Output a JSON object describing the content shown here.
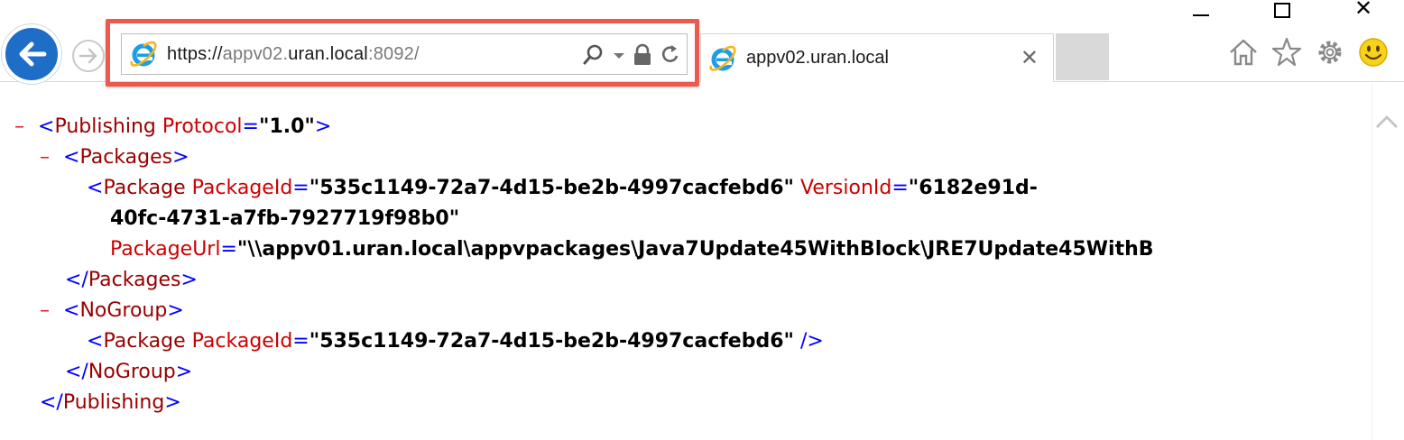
{
  "window": {
    "minimize_icon": "minimize-icon",
    "maximize_icon": "maximize-icon",
    "close_glyph": "✕"
  },
  "nav": {
    "back_icon": "back-arrow-icon",
    "forward_icon": "forward-arrow-icon"
  },
  "address": {
    "scheme": "https://",
    "host_prefix": "appv02.",
    "host_main": "uran.local",
    "port_path": ":8092/",
    "tools": [
      "search-icon",
      "dropdown-icon",
      "lock-icon",
      "refresh-icon"
    ]
  },
  "tab": {
    "title": "appv02.uran.local",
    "close_glyph": "✕"
  },
  "toolbar_icons": [
    "home-icon",
    "favorites-star-icon",
    "settings-gear-icon",
    "smiley-feedback-icon"
  ],
  "colors": {
    "back_button": "#1e6ec8",
    "highlight": "#ec5a4f",
    "xml_bracket": "#0000ff",
    "xml_tag": "#990000",
    "xml_attr": "#cc0000",
    "xml_toggle": "#dc1e28"
  },
  "xml": {
    "toggle": "–",
    "publishing": {
      "tag": "Publishing",
      "attr": "Protocol",
      "value": "\"1.0\""
    },
    "packages": {
      "tag": "Packages"
    },
    "package1": {
      "tag": "Package",
      "attr_id": "PackageId",
      "val_id": "\"535c1149-72a7-4d15-be2b-4997cacfebd6\"",
      "attr_version": "VersionId",
      "val_version_part1": "\"6182e91d-",
      "val_version_part2": "40fc-4731-a7fb-7927719f98b0\"",
      "attr_url": "PackageUrl",
      "val_url": "\"\\\\appv01.uran.local\\appvpackages\\Java7Update45WithBlock\\JRE7Update45WithB"
    },
    "packages_close": {
      "tag": "Packages"
    },
    "nogroup": {
      "tag": "NoGroup"
    },
    "package2": {
      "tag": "Package",
      "attr_id": "PackageId",
      "val_id": "\"535c1149-72a7-4d15-be2b-4997cacfebd6\""
    },
    "nogroup_close": {
      "tag": "NoGroup"
    },
    "publishing_close": {
      "tag": "Publishing"
    }
  }
}
